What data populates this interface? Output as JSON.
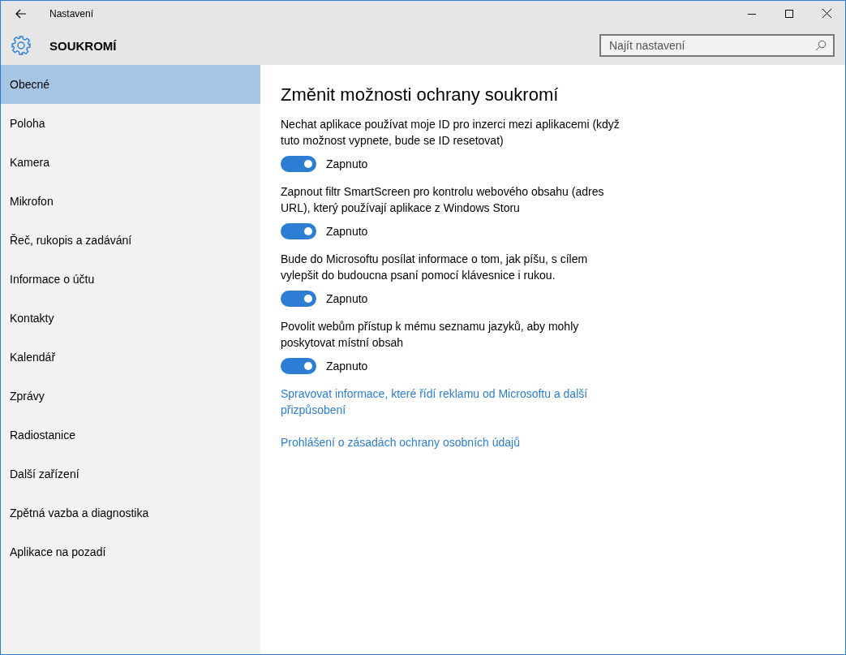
{
  "window": {
    "title": "Nastavení"
  },
  "header": {
    "title": "SOUKROMÍ",
    "search": {
      "placeholder": "Najít nastavení"
    }
  },
  "sidebar": {
    "items": [
      {
        "label": "Obecné",
        "selected": true
      },
      {
        "label": "Poloha",
        "selected": false
      },
      {
        "label": "Kamera",
        "selected": false
      },
      {
        "label": "Mikrofon",
        "selected": false
      },
      {
        "label": "Řeč, rukopis a zadávání",
        "selected": false
      },
      {
        "label": "Informace o účtu",
        "selected": false
      },
      {
        "label": "Kontakty",
        "selected": false
      },
      {
        "label": "Kalendář",
        "selected": false
      },
      {
        "label": "Zprávy",
        "selected": false
      },
      {
        "label": "Radiostanice",
        "selected": false
      },
      {
        "label": "Další zařízení",
        "selected": false
      },
      {
        "label": "Zpětná vazba a diagnostika",
        "selected": false
      },
      {
        "label": "Aplikace na pozadí",
        "selected": false
      }
    ]
  },
  "content": {
    "heading": "Změnit možnosti ochrany soukromí",
    "settings": [
      {
        "description": "Nechat aplikace používat moje ID pro inzerci mezi aplikacemi (když tuto možnost vypnete, bude se ID resetovat)",
        "on": true,
        "state_label": "Zapnuto"
      },
      {
        "description": "Zapnout filtr SmartScreen pro kontrolu webového obsahu (adres URL), který používají aplikace z Windows Storu",
        "on": true,
        "state_label": "Zapnuto"
      },
      {
        "description": "Bude do Microsoftu posílat informace o tom, jak píšu, s cílem vylepšit do budoucna psaní pomocí klávesnice i rukou.",
        "on": true,
        "state_label": "Zapnuto"
      },
      {
        "description": "Povolit webům přístup k mému seznamu jazyků, aby mohly poskytovat místní obsah",
        "on": true,
        "state_label": "Zapnuto"
      }
    ],
    "links": [
      "Spravovat informace, které řídí reklamu od Microsoftu a další přizpůsobení",
      "Prohlášení o zásadách ochrany osobních údajů"
    ]
  }
}
